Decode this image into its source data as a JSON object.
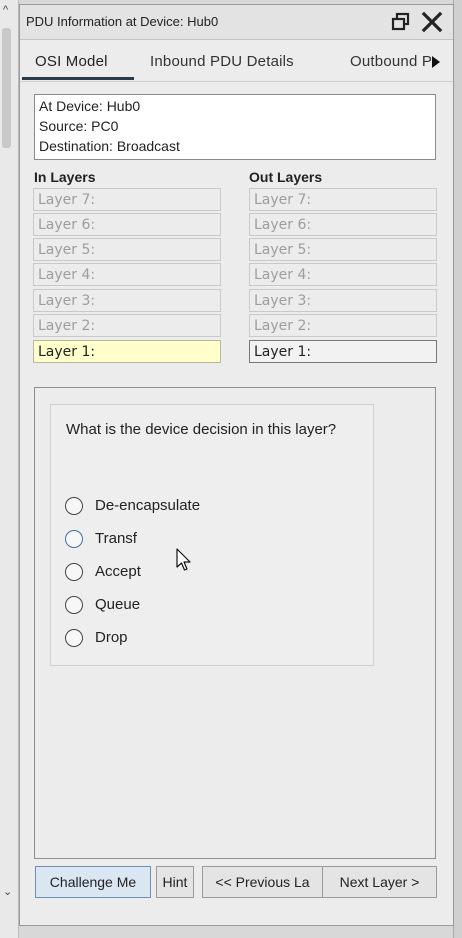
{
  "window": {
    "title": "PDU Information at Device: Hub0"
  },
  "tabs": [
    {
      "label": "OSI Model",
      "active": true
    },
    {
      "label": "Inbound PDU Details",
      "active": false
    },
    {
      "label": "Outbound P",
      "active": false
    }
  ],
  "info": {
    "device": "At Device: Hub0",
    "source": "Source: PC0",
    "destination": "Destination: Broadcast"
  },
  "in_layers": {
    "heading": "In Layers",
    "items": [
      "Layer 7:",
      "Layer 6:",
      "Layer 5:",
      "Layer 4:",
      "Layer 3:",
      "Layer 2:",
      "Layer 1:"
    ]
  },
  "out_layers": {
    "heading": "Out Layers",
    "items": [
      "Layer 7:",
      "Layer 6:",
      "Layer 5:",
      "Layer 4:",
      "Layer 3:",
      "Layer 2:",
      "Layer 1:"
    ]
  },
  "challenge": {
    "question": "What is the device decision in this layer?",
    "options": [
      "De-encapsulate",
      "Transf",
      "Accept",
      "Queue",
      "Drop"
    ]
  },
  "buttons": {
    "challenge": "Challenge Me",
    "hint": "Hint",
    "previous": "<< Previous La",
    "next": "Next Layer >"
  },
  "colors": {
    "active_layer_bg": "#ffffcc",
    "tab_underline": "#2a3a48",
    "challenge_button_bg": "#dbe6f3"
  }
}
